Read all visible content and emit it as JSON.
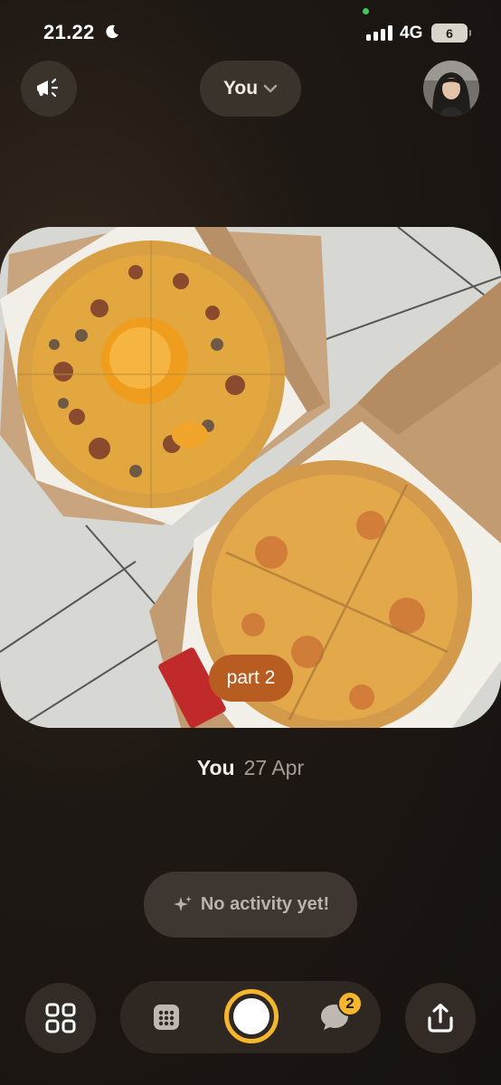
{
  "status_bar": {
    "time": "21.22",
    "network": "4G",
    "battery": "6"
  },
  "header": {
    "filter_label": "You"
  },
  "post": {
    "caption": "part 2",
    "author": "You",
    "date": "27 Apr"
  },
  "activity": {
    "label": "No activity yet!"
  },
  "bottom_nav": {
    "messages_badge": "2"
  },
  "colors": {
    "accent": "#f5b62c",
    "caption_bg": "#b85d22"
  }
}
